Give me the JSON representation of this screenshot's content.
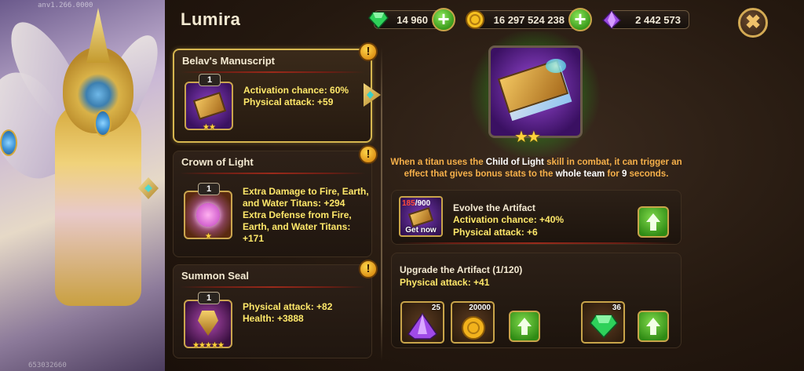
{
  "hero": {
    "name": "Lumira",
    "version_label": "anv1.266.0000",
    "user_id": "653032660"
  },
  "resources": [
    {
      "name": "emeralds",
      "icon": "emerald-icon",
      "value": "14 960",
      "color": "#34d65a"
    },
    {
      "name": "gold",
      "icon": "gold-coin-icon",
      "value": "16 297 524 238",
      "color": "#f2b21c"
    },
    {
      "name": "titan-potion",
      "icon": "purple-crystal-icon",
      "value": "2 442 573",
      "color": "#9a4ae0"
    }
  ],
  "close_symbol": "✖",
  "artifacts": [
    {
      "title": "Belav's Manuscript",
      "level": "1",
      "stars": "★★",
      "stats": [
        "Activation chance: 60%",
        "Physical attack: +59"
      ],
      "alert": "!",
      "selected": true
    },
    {
      "title": "Crown of Light",
      "level": "1",
      "stars": "★",
      "stats": [
        "Extra Damage to Fire, Earth,",
        "and Water Titans: +294",
        "Extra Defense from Fire,",
        "Earth, and Water Titans:",
        "+171"
      ],
      "alert": "!"
    },
    {
      "title": "Summon Seal",
      "level": "1",
      "stars": "★★★★★",
      "stats": [
        "Physical attack: +82",
        "Health: +3888"
      ],
      "alert": "!"
    }
  ],
  "detail": {
    "stars": "★★",
    "description": {
      "p1": "When a titan uses the ",
      "b1": "Child of Light",
      "p2": " skill in combat, it can trigger an effect that gives bonus stats to the ",
      "b2": "whole team",
      "p3": " for ",
      "b3": "9",
      "p4": " seconds."
    }
  },
  "evolve": {
    "title": "Evolve the Artifact",
    "have": "185",
    "need": "/900",
    "get_now": "Get now",
    "stats": [
      "Activation chance:  +40%",
      "Physical attack: +6"
    ]
  },
  "upgrade": {
    "title": "Upgrade the Artifact (1/120)",
    "stat": "Physical attack: +41",
    "costs": [
      {
        "icon": "purple-essence-icon",
        "amount": "25"
      },
      {
        "icon": "gold-pile-icon",
        "amount": "20000"
      },
      {
        "icon": "emerald-icon",
        "amount": "36"
      }
    ]
  }
}
